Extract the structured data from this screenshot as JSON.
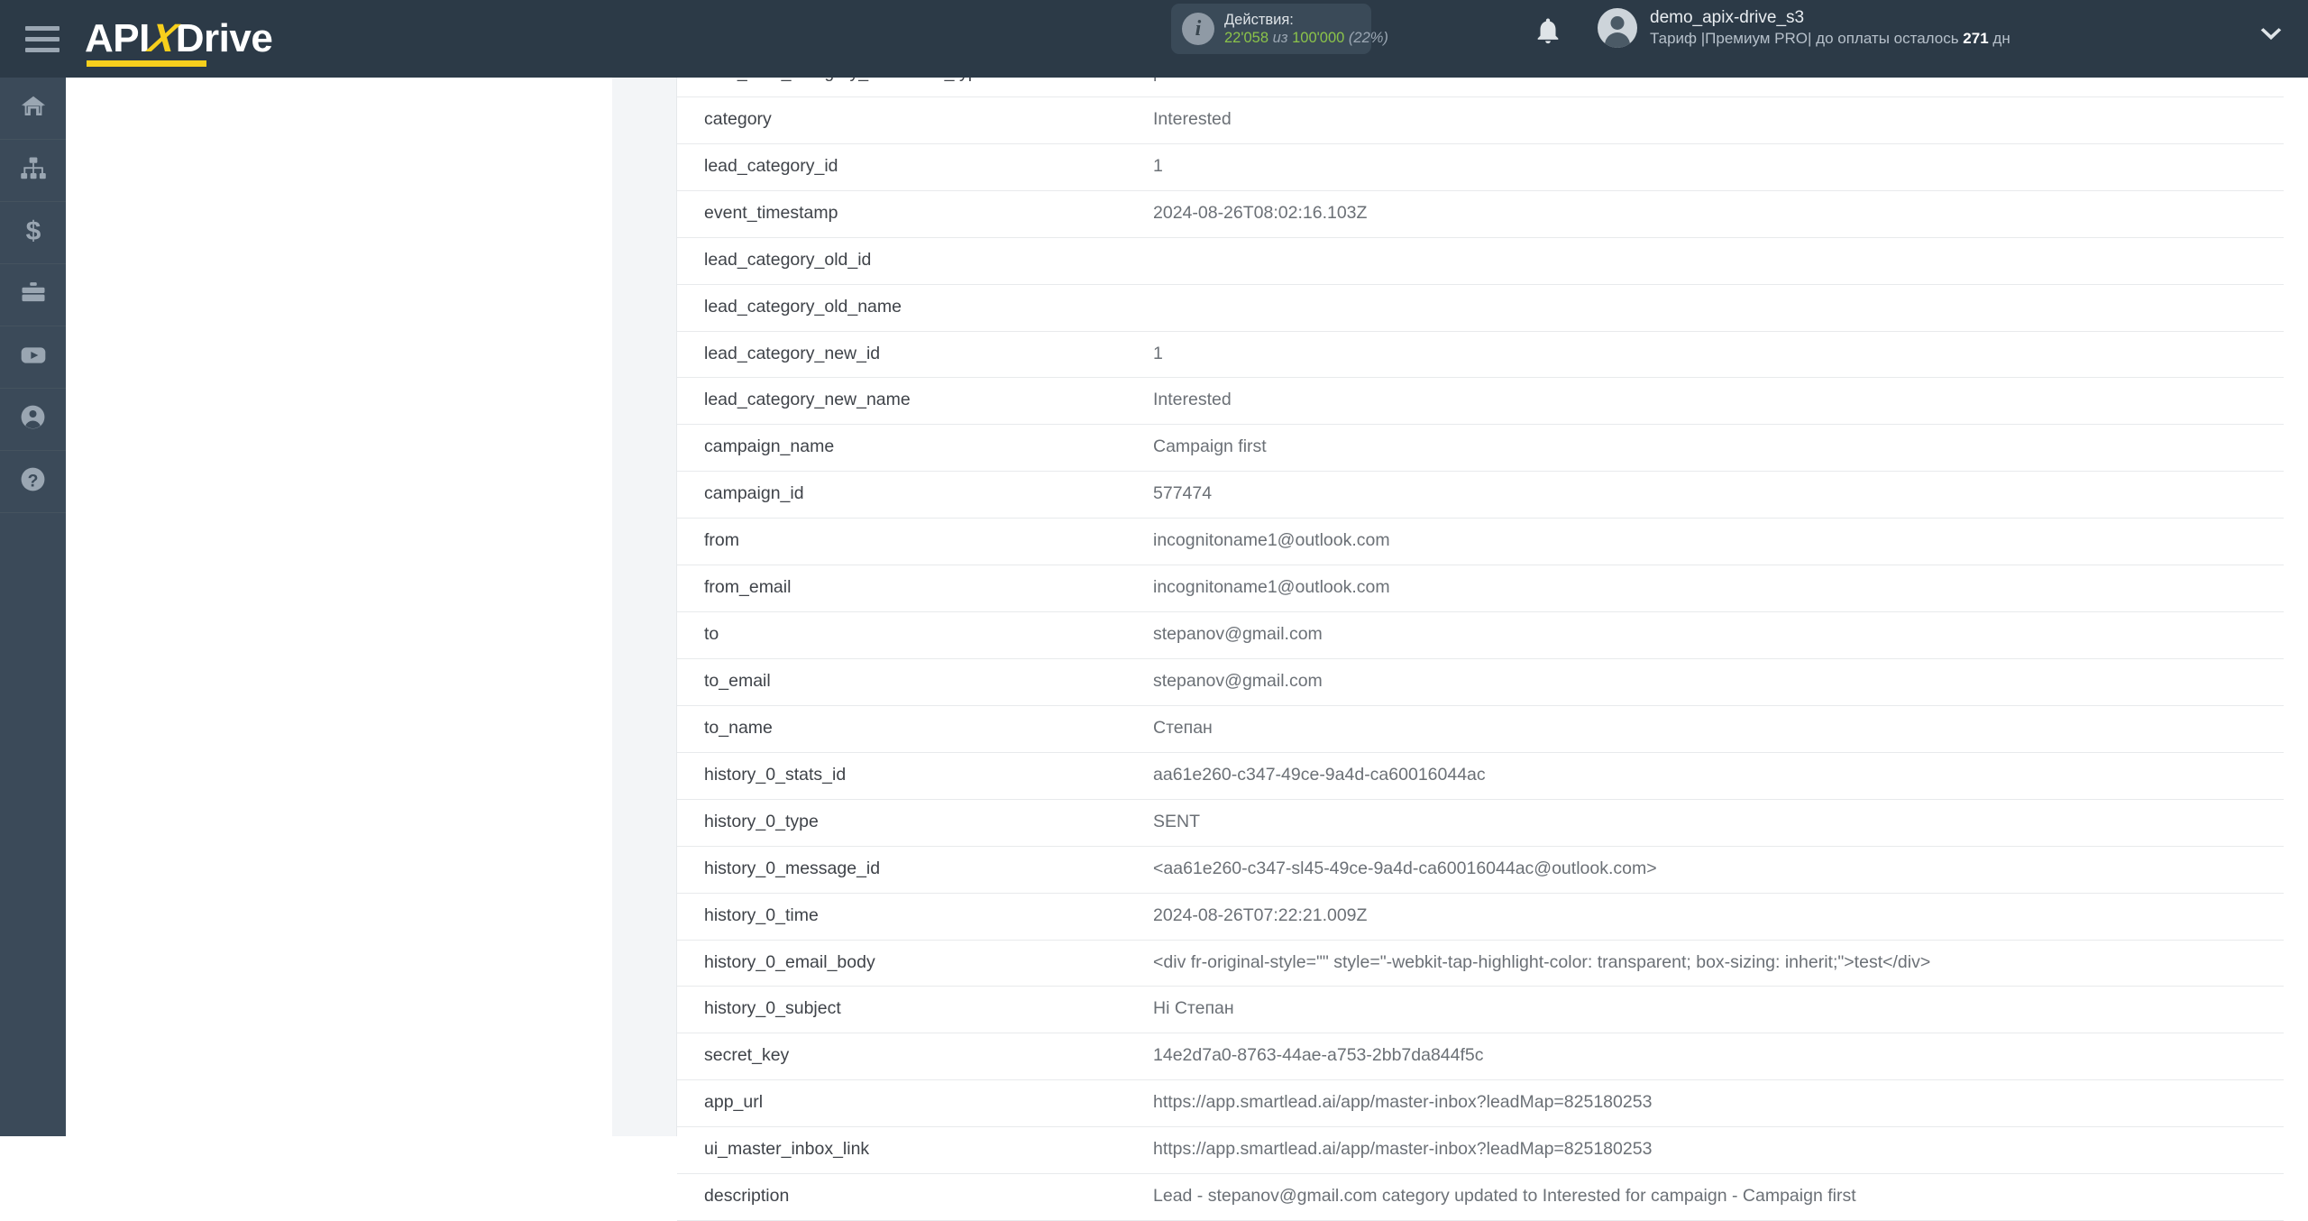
{
  "header": {
    "logo": {
      "prefix": "API",
      "x": "X",
      "suffix": "Drive"
    },
    "hamburger_name": "menu-icon",
    "actions": {
      "label": "Действия:",
      "used": "22'058",
      "of": "из",
      "total": "100'000",
      "percent": "(22%)"
    },
    "user": {
      "name": "demo_apix-drive_s3",
      "plan_prefix": "Тариф |Премиум PRO| до оплаты осталось ",
      "plan_days": "271",
      "plan_suffix": " дн"
    }
  },
  "sidebar": {
    "items": [
      {
        "icon": "home-icon",
        "name": "sidebar-item-home"
      },
      {
        "icon": "connections-icon",
        "name": "sidebar-item-connections"
      },
      {
        "icon": "dollar-icon",
        "name": "sidebar-item-billing"
      },
      {
        "icon": "briefcase-icon",
        "name": "sidebar-item-business"
      },
      {
        "icon": "youtube-icon",
        "name": "sidebar-item-youtube"
      },
      {
        "icon": "user-icon",
        "name": "sidebar-item-account"
      },
      {
        "icon": "help-icon",
        "name": "sidebar-item-help"
      }
    ]
  },
  "table": {
    "rows": [
      {
        "key": "lead_data_category_sentiment_type",
        "value": "positive"
      },
      {
        "key": "category",
        "value": "Interested"
      },
      {
        "key": "lead_category_id",
        "value": "1"
      },
      {
        "key": "event_timestamp",
        "value": "2024-08-26T08:02:16.103Z"
      },
      {
        "key": "lead_category_old_id",
        "value": ""
      },
      {
        "key": "lead_category_old_name",
        "value": ""
      },
      {
        "key": "lead_category_new_id",
        "value": "1"
      },
      {
        "key": "lead_category_new_name",
        "value": "Interested"
      },
      {
        "key": "campaign_name",
        "value": "Campaign first"
      },
      {
        "key": "campaign_id",
        "value": "577474"
      },
      {
        "key": "from",
        "value": "incognitoname1@outlook.com"
      },
      {
        "key": "from_email",
        "value": "incognitoname1@outlook.com"
      },
      {
        "key": "to",
        "value": "stepanov@gmail.com"
      },
      {
        "key": "to_email",
        "value": "stepanov@gmail.com"
      },
      {
        "key": "to_name",
        "value": "Степан"
      },
      {
        "key": "history_0_stats_id",
        "value": "aa61e260-c347-49ce-9a4d-ca60016044ac"
      },
      {
        "key": "history_0_type",
        "value": "SENT"
      },
      {
        "key": "history_0_message_id",
        "value": "<aa61e260-c347-sl45-49ce-9a4d-ca60016044ac@outlook.com>"
      },
      {
        "key": "history_0_time",
        "value": "2024-08-26T07:22:21.009Z"
      },
      {
        "key": "history_0_email_body",
        "value": "<div fr-original-style=\"\" style=\"-webkit-tap-highlight-color: transparent; box-sizing: inherit;\">test</div>"
      },
      {
        "key": "history_0_subject",
        "value": "Hi Степан"
      },
      {
        "key": "secret_key",
        "value": "14e2d7a0-8763-44ae-a753-2bb7da844f5c"
      },
      {
        "key": "app_url",
        "value": "https://app.smartlead.ai/app/master-inbox?leadMap=825180253"
      },
      {
        "key": "ui_master_inbox_link",
        "value": "https://app.smartlead.ai/app/master-inbox?leadMap=825180253"
      },
      {
        "key": "description",
        "value": "Lead - stepanov@gmail.com category updated to Interested for campaign - Campaign first"
      }
    ]
  },
  "colors": {
    "header_bg": "#2c3a47",
    "sidebar_bg": "#3b4a59",
    "accent_yellow": "#f7cf1c",
    "accent_green": "#8bc34a"
  }
}
